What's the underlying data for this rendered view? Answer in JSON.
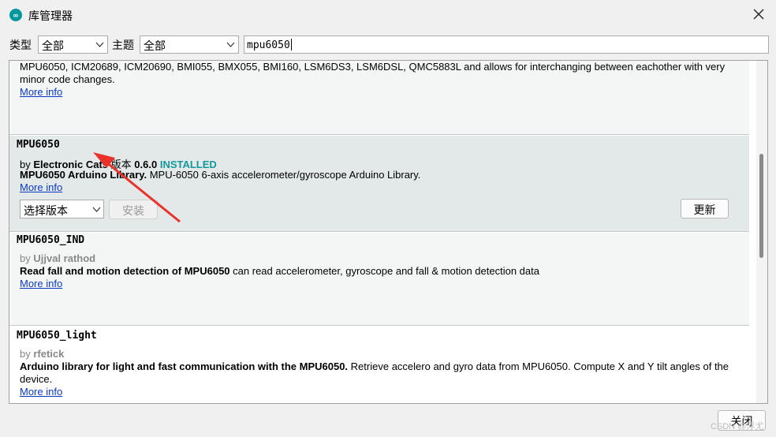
{
  "window": {
    "title": "库管理器"
  },
  "filters": {
    "type_label": "类型",
    "type_value": "全部",
    "topic_label": "主题",
    "topic_value": "全部",
    "search_value": "mpu6050"
  },
  "libraries": [
    {
      "description": "MPU6050, ICM20689, ICM20690, BMI055, BMX055, BMI160, LSM6DS3, LSM6DSL, QMC5883L and allows for interchanging between eachother with very minor code changes.",
      "more_info": "More info"
    },
    {
      "name": "MPU6050",
      "by_prefix": "by",
      "author": "Electronic Cats",
      "version_label": "版本",
      "version": "0.6.0",
      "status": "INSTALLED",
      "desc_bold": "MPU6050 Arduino Library.",
      "desc": "MPU-6050 6-axis accelerometer/gyroscope Arduino Library.",
      "more_info": "More info",
      "select_version": "选择版本",
      "install_label": "安装",
      "update_label": "更新"
    },
    {
      "name": "MPU6050_IND",
      "by_prefix": "by",
      "author": "Ujjval rathod",
      "desc_bold": "Read fall and motion detection of MPU6050",
      "desc": "can read accelerometer, gyroscope and fall & motion detection data",
      "more_info": "More info"
    },
    {
      "name": "MPU6050_light",
      "by_prefix": "by",
      "author": "rfetick",
      "desc_bold": "Arduino library for light and fast communication with the MPU6050.",
      "desc": "Retrieve accelero and gyro data from MPU6050. Compute X and Y tilt angles of the device.",
      "more_info": "More info"
    }
  ],
  "footer": {
    "close_label": "关闭",
    "watermark": "CSDN @浮尤"
  },
  "colors": {
    "accent": "#00979c",
    "installed": "#13999b",
    "link": "#0b3bc6",
    "annotation_arrow": "#e8322b"
  }
}
